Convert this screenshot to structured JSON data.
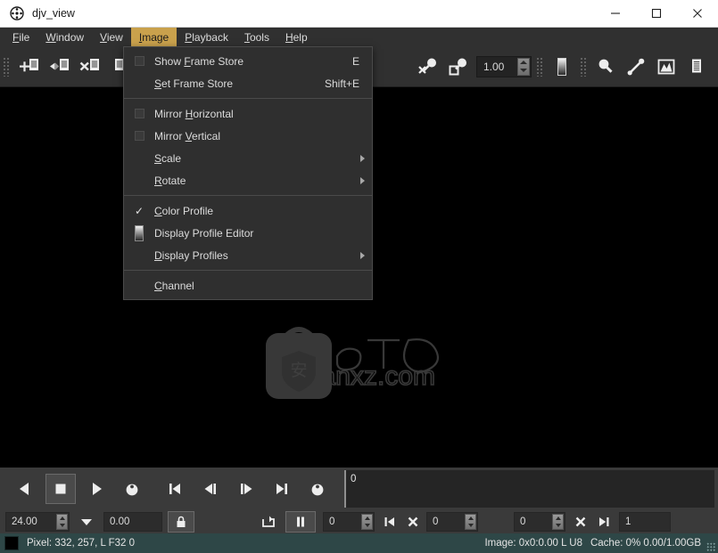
{
  "window": {
    "title": "djv_view",
    "icon": "film-reel-icon",
    "controls": [
      {
        "name": "minimize-button",
        "glyph": "minimize-icon"
      },
      {
        "name": "maximize-button",
        "glyph": "maximize-icon"
      },
      {
        "name": "close-button",
        "glyph": "close-icon"
      }
    ]
  },
  "menubar": {
    "items": [
      {
        "label": "File",
        "mnemonic": "F",
        "active": false
      },
      {
        "label": "Window",
        "mnemonic": "W",
        "active": false
      },
      {
        "label": "View",
        "mnemonic": "V",
        "active": false
      },
      {
        "label": "Image",
        "mnemonic": "I",
        "active": true
      },
      {
        "label": "Playback",
        "mnemonic": "P",
        "active": false
      },
      {
        "label": "Tools",
        "mnemonic": "T",
        "active": false
      },
      {
        "label": "Help",
        "mnemonic": "H",
        "active": false
      }
    ]
  },
  "toolbar": {
    "zoom_value": "1.00",
    "buttons": [
      {
        "name": "file-open-button",
        "icon": "document-plus-icon"
      },
      {
        "name": "file-reload-button",
        "icon": "document-mirror-icon"
      },
      {
        "name": "file-close-button",
        "icon": "document-close-icon"
      },
      {
        "name": "window-new-button",
        "icon": "document-icon"
      },
      {
        "name": "view-fit-button",
        "icon": "magnifier-cross-icon"
      },
      {
        "name": "view-frame-button",
        "icon": "magnifier-box-icon"
      },
      {
        "name": "display-profile-button",
        "icon": "gradient-icon"
      },
      {
        "name": "zoom-tool-button",
        "icon": "magnifier-icon"
      },
      {
        "name": "color-picker-button",
        "icon": "eyedropper-icon"
      },
      {
        "name": "histogram-button",
        "icon": "histogram-icon"
      },
      {
        "name": "info-button",
        "icon": "text-lines-icon"
      }
    ]
  },
  "image_menu": {
    "items": [
      {
        "kind": "item",
        "label": "Show Frame Store",
        "mnemonic": "F",
        "mnemonic_index": 5,
        "shortcut": "E",
        "icon": "checkbox-empty-icon",
        "submenu": false
      },
      {
        "kind": "item",
        "label": "Set Frame Store",
        "mnemonic": "S",
        "mnemonic_index": 0,
        "shortcut": "Shift+E",
        "icon": "",
        "submenu": false
      },
      {
        "kind": "separator"
      },
      {
        "kind": "item",
        "label": "Mirror Horizontal",
        "mnemonic": "H",
        "mnemonic_index": 7,
        "shortcut": "",
        "icon": "checkbox-empty-icon",
        "submenu": false
      },
      {
        "kind": "item",
        "label": "Mirror Vertical",
        "mnemonic": "V",
        "mnemonic_index": 7,
        "shortcut": "",
        "icon": "checkbox-empty-icon",
        "submenu": false
      },
      {
        "kind": "item",
        "label": "Scale",
        "mnemonic": "S",
        "mnemonic_index": 0,
        "shortcut": "",
        "icon": "",
        "submenu": true
      },
      {
        "kind": "item",
        "label": "Rotate",
        "mnemonic": "R",
        "mnemonic_index": 0,
        "shortcut": "",
        "icon": "",
        "submenu": true
      },
      {
        "kind": "separator"
      },
      {
        "kind": "item",
        "label": "Color Profile",
        "mnemonic": "C",
        "mnemonic_index": 0,
        "shortcut": "",
        "icon": "check-icon",
        "submenu": false
      },
      {
        "kind": "item",
        "label": "Display Profile Editor",
        "mnemonic": "",
        "mnemonic_index": -1,
        "shortcut": "",
        "icon": "gradient-icon",
        "submenu": false
      },
      {
        "kind": "item",
        "label": "Display Profiles",
        "mnemonic": "D",
        "mnemonic_index": 0,
        "shortcut": "",
        "icon": "",
        "submenu": true
      },
      {
        "kind": "separator"
      },
      {
        "kind": "item",
        "label": "Channel",
        "mnemonic": "C",
        "mnemonic_index": 0,
        "shortcut": "",
        "icon": "",
        "submenu": false
      }
    ]
  },
  "playback": {
    "buttons": [
      {
        "name": "playback-reverse-button",
        "icon": "play-reverse-icon",
        "selected": false
      },
      {
        "name": "playback-stop-button",
        "icon": "stop-icon",
        "selected": true
      },
      {
        "name": "playback-forward-button",
        "icon": "play-forward-icon",
        "selected": false
      },
      {
        "name": "playback-loop-mode-button",
        "icon": "circle-marker-icon",
        "selected": false
      },
      {
        "name": "frame-start-button",
        "icon": "skip-start-icon",
        "selected": false
      },
      {
        "name": "frame-prev-button",
        "icon": "step-back-icon",
        "selected": false
      },
      {
        "name": "frame-next-button",
        "icon": "step-forward-icon",
        "selected": false
      },
      {
        "name": "frame-end-button",
        "icon": "skip-end-icon",
        "selected": false
      },
      {
        "name": "frame-marker-button",
        "icon": "circle-marker-icon",
        "selected": false
      }
    ],
    "timeline_value": "0"
  },
  "controls": {
    "fps_value": "24.00",
    "speed_dropdown_icon": "chevron-down-icon",
    "actual_fps_value": "0.00",
    "lock_icon": "lock-icon",
    "loop_icon": "loop-icon",
    "pause_icon": "pause-icon",
    "frame_value": "0",
    "in_point_value": "0",
    "in_set_icon": "skip-start-icon",
    "in_clear_icon": "close-x-icon",
    "start_value": "0",
    "end_value": "0",
    "out_clear_icon": "close-x-icon",
    "out_set_icon": "skip-end-icon",
    "duration_value": "1"
  },
  "statusbar": {
    "swatch_color": "#000000",
    "pixel_text": "Pixel: 332, 257, L F32 0",
    "image_text": "Image: 0x0:0.00 L U8",
    "cache_text": "Cache: 0% 0.00/1.00GB"
  },
  "watermark": {
    "site": "anxz.com",
    "logo_text": "安"
  }
}
